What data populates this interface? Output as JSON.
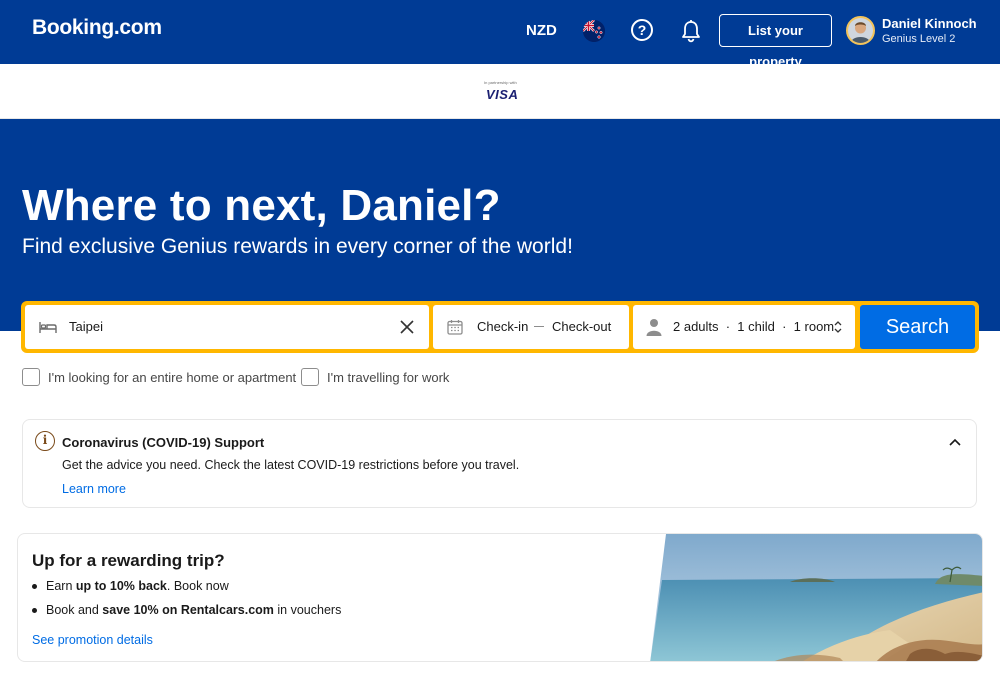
{
  "header": {
    "logo": "Booking.com",
    "currency": "NZD",
    "flag_icon": "nz-flag-icon",
    "help_icon": "question-circle-icon",
    "help_glyph": "?",
    "notifications_icon": "bell-icon",
    "list_property": "List your property",
    "user_name": "Daniel Kinnoch",
    "user_level": "Genius Level 2"
  },
  "sponsor": {
    "tagline": "In partnership with",
    "logo": "VISA"
  },
  "hero": {
    "title": "Where to next, Daniel?",
    "subtitle": "Find exclusive Genius rewards in every corner of the world!"
  },
  "search": {
    "destination": "Taipei",
    "checkin": "Check-in",
    "checkout": "Check-out",
    "guests": "2 adults  ·  1 child  ·  1 room",
    "button": "Search"
  },
  "options": {
    "entire_home": "I'm looking for an entire home or apartment",
    "work_travel": "I'm travelling for work"
  },
  "covid": {
    "info_glyph": "i",
    "title": "Coronavirus (COVID-19) Support",
    "text": "Get the advice you need. Check the latest COVID-19 restrictions before you travel.",
    "link": "Learn more"
  },
  "promo": {
    "title": "Up for a rewarding trip?",
    "bullet1_pre": "Earn ",
    "bullet1_bold": "up to 10% back",
    "bullet1_post": ". Book now",
    "bullet2_pre": "Book and ",
    "bullet2_bold": "save 10% on Rentalcars.com",
    "bullet2_post": " in vouchers",
    "link": "See promotion details",
    "image": "beach-photo"
  },
  "colors": {
    "brand_blue": "#003b95",
    "search_border": "#ffb700",
    "button_blue": "#006ce4"
  }
}
